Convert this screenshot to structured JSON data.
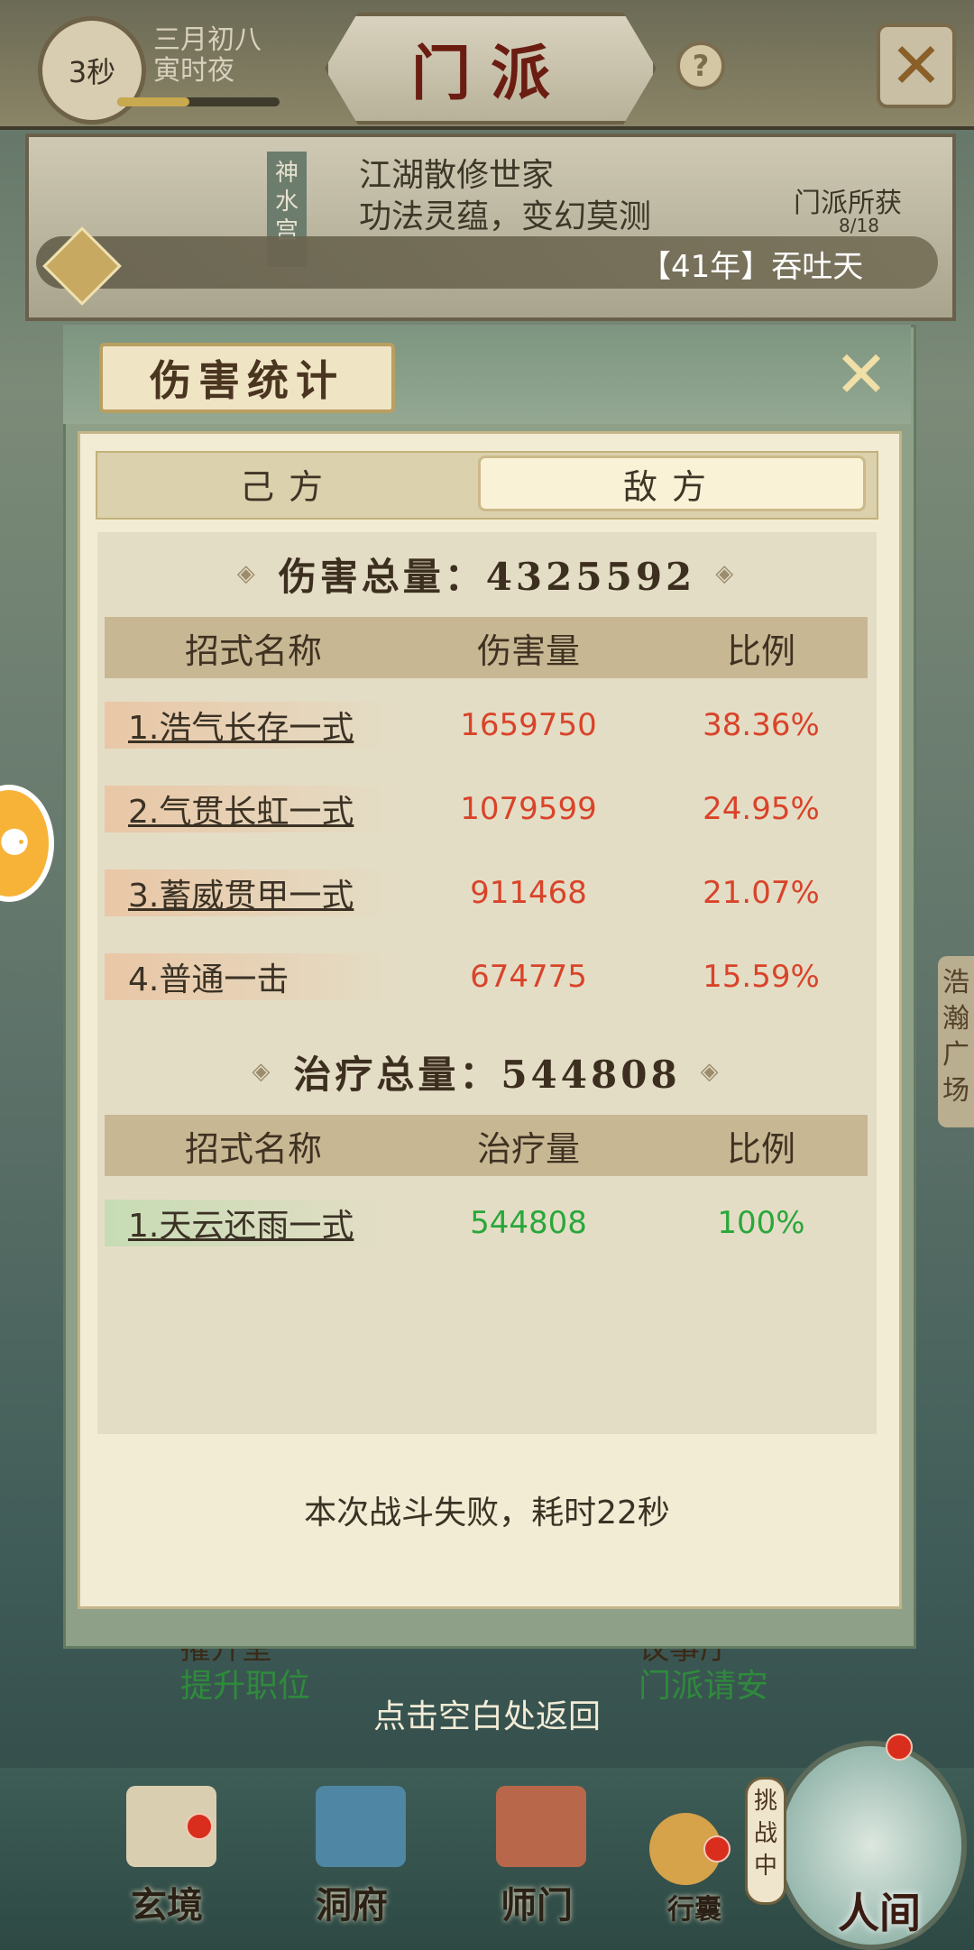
{
  "header": {
    "timer": "3秒",
    "date_line1": "三月初八",
    "date_line2": "寅时夜",
    "title": "门派",
    "help": "?",
    "close": "✕"
  },
  "sect": {
    "name": "神水宫",
    "desc_line1": "江湖散修世家",
    "desc_line2": "功法灵蕴，变幻莫测",
    "gain_label": "门派所获",
    "gain_count": "8/18"
  },
  "ticker": {
    "text": "【41年】吞吐天"
  },
  "side": {
    "badge": "浩瀚广场"
  },
  "modal": {
    "title": "伤害统计",
    "close": "✕",
    "tabs": {
      "mine": "己方",
      "enemy": "敌方"
    },
    "damage": {
      "title": "伤害总量：4325592",
      "col_name": "招式名称",
      "col_value": "伤害量",
      "col_pct": "比例",
      "rows": [
        {
          "name": "1.浩气长存一式",
          "value": "1659750",
          "pct": "38.36%"
        },
        {
          "name": "2.气贯长虹一式",
          "value": "1079599",
          "pct": "24.95%"
        },
        {
          "name": "3.蓄威贯甲一式",
          "value": "911468",
          "pct": "21.07%"
        },
        {
          "name": "4.普通一击",
          "value": "674775",
          "pct": "15.59%"
        }
      ]
    },
    "heal": {
      "title": "治疗总量：544808",
      "col_name": "招式名称",
      "col_value": "治疗量",
      "col_pct": "比例",
      "rows": [
        {
          "name": "1.天云还雨一式",
          "value": "544808",
          "pct": "100%"
        }
      ]
    },
    "result": "本次战斗失败，耗时22秒"
  },
  "behind": {
    "left_title": "擢升堂",
    "left_action": "提升职位",
    "right_title": "议事厅",
    "right_action": "门派请安"
  },
  "hint": "点击空白处返回",
  "nav": {
    "items": [
      "玄境",
      "洞府",
      "师门",
      "行囊"
    ],
    "challenge": "挑战中",
    "world": "人间"
  }
}
